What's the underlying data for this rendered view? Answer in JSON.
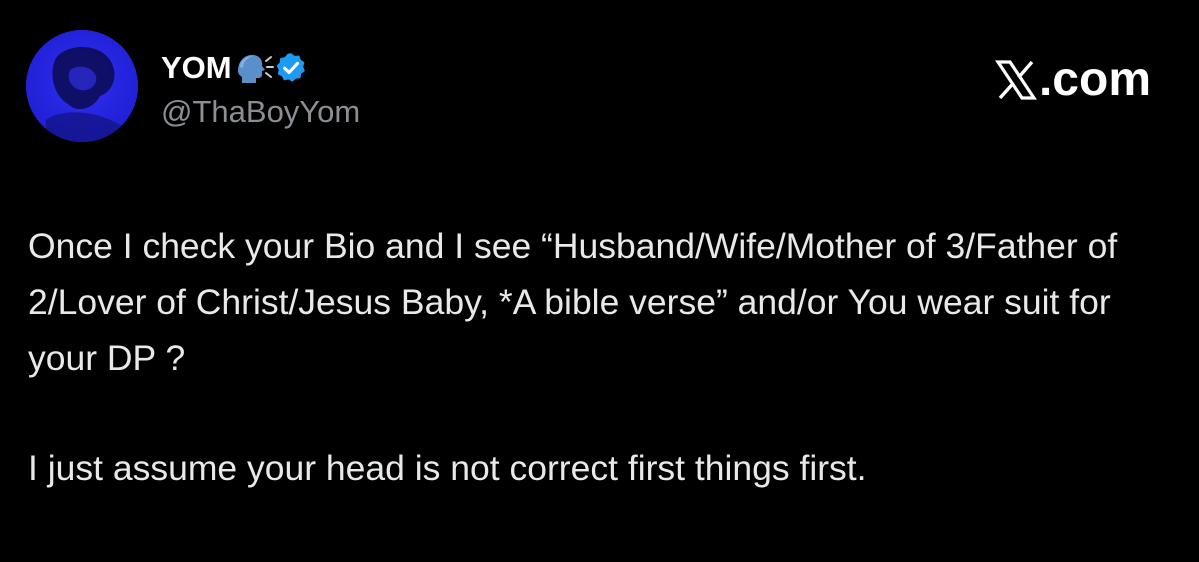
{
  "author": {
    "display_name": "YOM",
    "emoji_icon": "speaking-head-icon",
    "verified_icon": "verified-badge-icon",
    "handle": "@ThaBoyYom"
  },
  "brand": {
    "logo_icon": "x-logo-icon",
    "text": ".com"
  },
  "tweet": {
    "paragraphs": [
      "Once I check your Bio and I see “Husband/Wife/Mother of 3/Father of 2/Lover of Christ/Jesus Baby, *A bible verse” and/or You wear suit for your DP ?",
      "I just assume your head is not correct first things first."
    ]
  },
  "colors": {
    "background": "#000000",
    "text_primary": "#e7e9ea",
    "text_secondary": "#8b8f94",
    "verified_blue": "#1d9bf0",
    "avatar_blue": "#2424e0"
  }
}
